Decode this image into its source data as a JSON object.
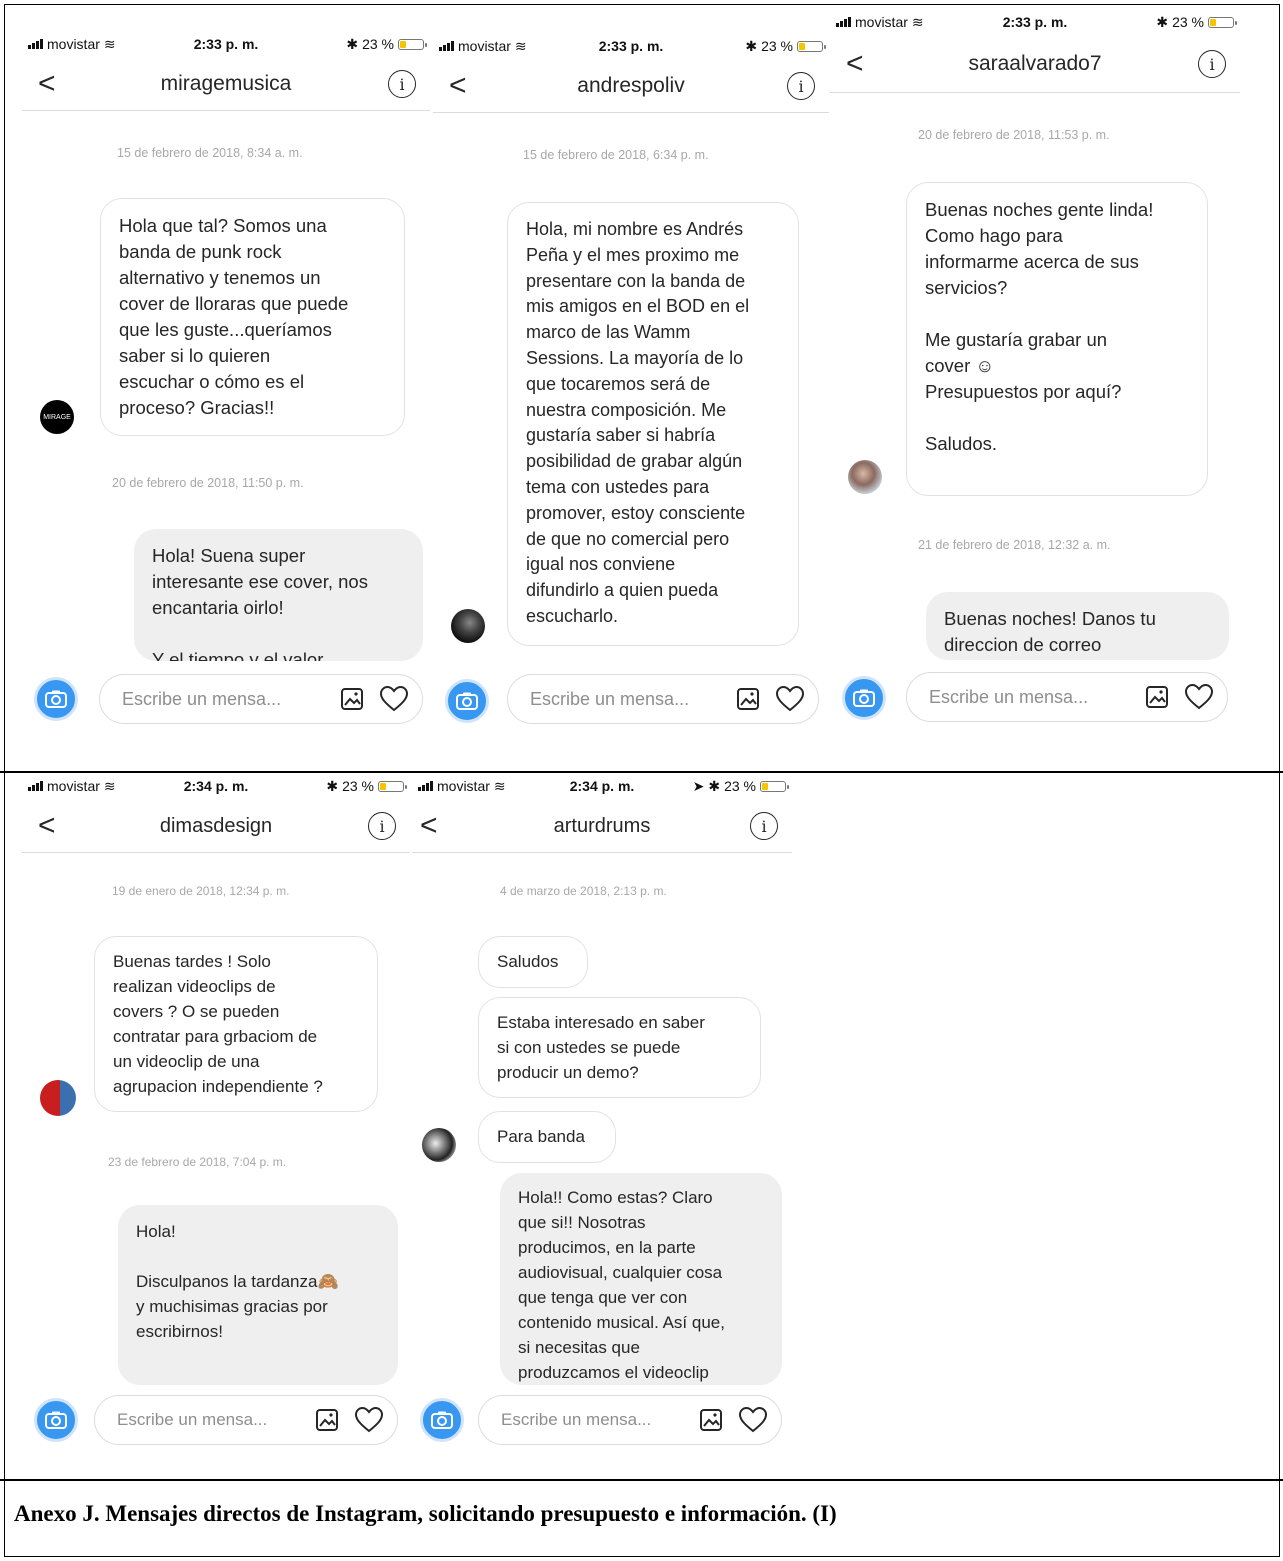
{
  "caption": "Anexo J. Mensajes directos de Instagram, solicitando presupuesto e información. (I)",
  "input_placeholder": "Escribe un mensa...",
  "colors": {
    "accent": "#3897f0",
    "battery": "#f6c400",
    "bubble_out": "#efefef"
  },
  "panels": [
    {
      "carrier": "movistar",
      "time": "2:33 p. m.",
      "battery": "23 %",
      "username": "miragemusica",
      "date1": "15 de febrero de 2018, 8:34 a. m.",
      "msg1": "Hola que tal? Somos una\nbanda de punk rock\nalternativo y tenemos un\ncover de lloraras que puede\nque les guste...queríamos\nsaber si lo quieren\nescuchar o cómo es el\nproceso? Gracias!!",
      "avatar_text": "MIRAGE",
      "date2": "20 de febrero de 2018, 11:50 p. m.",
      "msg2": "Hola! Suena super\ninteresante ese cover, nos\nencantaria oirlo!\n\nY el tiempo y el valor"
    },
    {
      "carrier": "movistar",
      "time": "2:33 p. m.",
      "battery": "23 %",
      "username": "andrespoliv",
      "date1": "15 de febrero de 2018, 6:34 p. m.",
      "msg1": "Hola, mi nombre es Andrés\nPeña y el mes proximo me\npresentare con la banda de\nmis amigos en el BOD en el\nmarco de las Wamm\nSessions. La mayoría de lo\nque tocaremos será de\nnuestra composición. Me\ngustaría saber si habría\nposibilidad de grabar algún\ntema con ustedes para\npromover, estoy consciente\nde que no comercial pero\nigual nos conviene\ndifundirlo a quien pueda\nescucharlo."
    },
    {
      "carrier": "movistar",
      "time": "2:33 p. m.",
      "battery": "23 %",
      "username": "saraalvarado7",
      "date1": "20 de febrero de 2018, 11:53 p. m.",
      "msg1": "Buenas noches gente linda!\nComo hago para\ninformarme acerca de sus\nservicios?\n\nMe gustaría grabar un\ncover ☺\nPresupuestos por aquí?\n\nSaludos.",
      "date2": "21 de febrero de 2018, 12:32 a. m.",
      "msg2": "Buenas noches! Danos tu\ndireccion de correo"
    },
    {
      "carrier": "movistar",
      "time": "2:34 p. m.",
      "battery": "23 %",
      "username": "dimasdesign",
      "date1": "19 de enero de 2018, 12:34 p. m.",
      "msg1": "Buenas tardes ! Solo\nrealizan videoclips de\ncovers ? O se pueden\ncontratar para grbaciom de\nun videoclip de una\nagrupacion independiente ?",
      "date2": "23 de febrero de 2018, 7:04 p. m.",
      "msg2": "Hola!\n\nDisculpanos la tardanza🙈\ny muchisimas gracias por\nescribirnos!"
    },
    {
      "carrier": "movistar",
      "time": "2:34 p. m.",
      "battery": "23 %",
      "username": "arturdrums",
      "date1": "4 de marzo de 2018, 2:13 p. m.",
      "msg1": "Saludos",
      "msg2": "Estaba interesado en saber\nsi con ustedes se puede\nproducir un demo?",
      "msg3": "Para banda",
      "msg4": "Hola!! Como estas? Claro\nque si!! Nosotras\nproducimos, en la parte\naudiovisual, cualquier cosa\nque tenga que ver con\ncontenido musical. Así que,\nsi necesitas que\nproduzcamos el videoclip"
    }
  ]
}
